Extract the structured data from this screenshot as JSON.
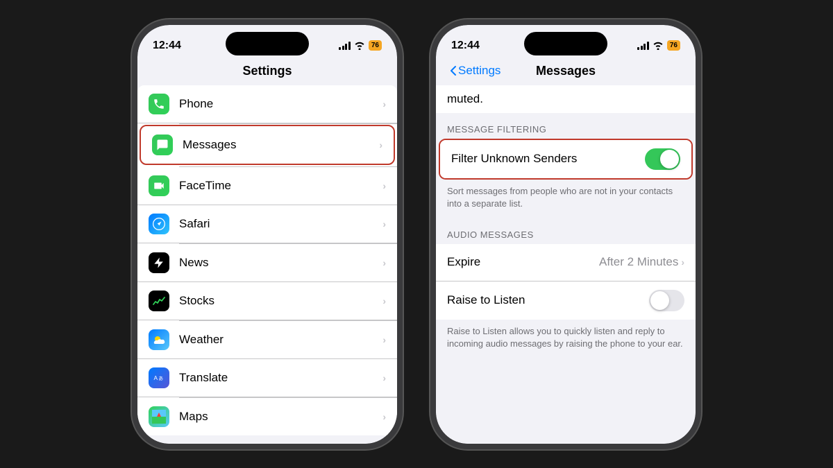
{
  "left_phone": {
    "time": "12:44",
    "battery": "76",
    "title": "Settings",
    "items": [
      {
        "id": "phone",
        "label": "Phone",
        "icon_class": "icon-phone",
        "icon_char": "📞"
      },
      {
        "id": "messages",
        "label": "Messages",
        "icon_class": "icon-messages",
        "icon_char": "💬",
        "highlighted": true
      },
      {
        "id": "facetime",
        "label": "FaceTime",
        "icon_class": "icon-facetime",
        "icon_char": "📹"
      },
      {
        "id": "safari",
        "label": "Safari",
        "icon_class": "icon-safari",
        "icon_char": "🧭"
      },
      {
        "id": "news",
        "label": "News",
        "icon_class": "icon-news",
        "icon_char": "📰"
      },
      {
        "id": "stocks",
        "label": "Stocks",
        "icon_class": "icon-stocks",
        "icon_char": "📈"
      },
      {
        "id": "weather",
        "label": "Weather",
        "icon_class": "icon-weather",
        "icon_char": "⛅"
      },
      {
        "id": "translate",
        "label": "Translate",
        "icon_class": "icon-translate",
        "icon_char": "🌐"
      },
      {
        "id": "maps",
        "label": "Maps",
        "icon_class": "icon-maps",
        "icon_char": "🗺"
      }
    ]
  },
  "right_phone": {
    "time": "12:44",
    "battery": "76",
    "back_label": "Settings",
    "title": "Messages",
    "muted_text": "muted.",
    "message_filtering_header": "MESSAGE FILTERING",
    "filter_unknown_senders_label": "Filter Unknown Senders",
    "filter_unknown_senders_state": true,
    "filter_description": "Sort messages from people who are not in your contacts into a separate list.",
    "audio_messages_header": "AUDIO MESSAGES",
    "expire_label": "Expire",
    "expire_value": "After 2 Minutes",
    "raise_to_listen_label": "Raise to Listen",
    "raise_to_listen_state": false,
    "raise_description": "Raise to Listen allows you to quickly listen and reply to incoming audio messages by raising the phone to your ear."
  }
}
